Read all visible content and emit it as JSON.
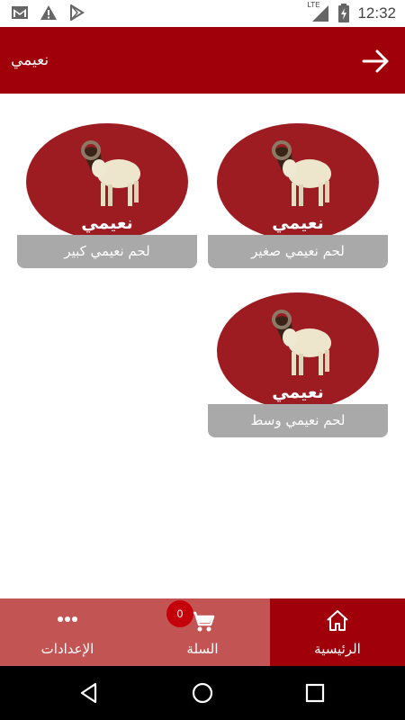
{
  "status_bar": {
    "time": "12:32",
    "network_label": "LTE"
  },
  "app_bar": {
    "title": "نعيمي"
  },
  "products": [
    {
      "badge": "نعيمي",
      "label": "لحم نعيمي صغير"
    },
    {
      "badge": "نعيمي",
      "label": "لحم نعيمي كبير"
    },
    {
      "badge": "نعيمي",
      "label": "لحم نعيمي وسط"
    }
  ],
  "bottom_nav": {
    "home_label": "الرئيسية",
    "cart_label": "السلة",
    "cart_count": "0",
    "settings_label": "الإعدادات"
  },
  "colors": {
    "primary": "#a00009",
    "nav_secondary": "#c35454",
    "circle": "#9c1c22",
    "card_label_bg": "#a9a9a9",
    "badge": "#c4000a"
  },
  "icons": {
    "status_left": [
      "gmail-icon",
      "warning-icon",
      "play-store-icon"
    ],
    "status_right": [
      "lte-signal-icon",
      "battery-icon"
    ],
    "app_bar": "arrow-right-icon",
    "nav": [
      "more-dots-icon",
      "cart-icon",
      "home-icon"
    ],
    "system": [
      "back-triangle-icon",
      "home-circle-icon",
      "recents-square-icon"
    ]
  }
}
